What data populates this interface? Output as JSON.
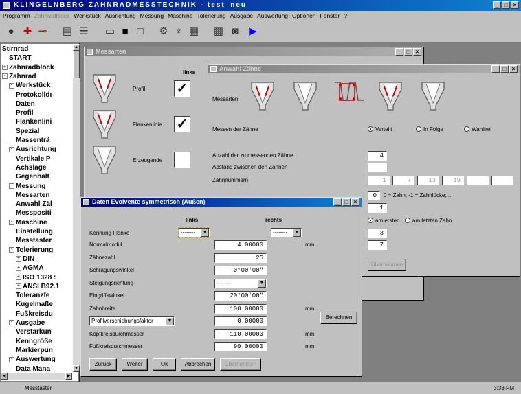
{
  "app": {
    "title": "KLINGELNBERG ZAHNRADMESSTECHNIK - test_neu"
  },
  "menu": [
    "Programm",
    "Zahnradblock",
    "Werkstück",
    "Ausrichtung",
    "Messung",
    "Maschine",
    "Tolerierung",
    "Ausgabe",
    "Auswertung",
    "Optionen",
    "Fenster",
    "?"
  ],
  "menu_disabled_index": 1,
  "tree": [
    {
      "label": "Stirnrad",
      "level": 0,
      "toggle": ""
    },
    {
      "label": "START",
      "level": 1,
      "toggle": ""
    },
    {
      "label": "Zahnradblock",
      "level": 0,
      "toggle": "+"
    },
    {
      "label": "Zahnrad",
      "level": 0,
      "toggle": "-"
    },
    {
      "label": "Werkstück",
      "level": 1,
      "toggle": "-"
    },
    {
      "label": "Protokolldı",
      "level": 2,
      "toggle": ""
    },
    {
      "label": "Daten",
      "level": 2,
      "toggle": ""
    },
    {
      "label": "Profil",
      "level": 2,
      "toggle": ""
    },
    {
      "label": "Flankenlini",
      "level": 2,
      "toggle": ""
    },
    {
      "label": "Spezial",
      "level": 2,
      "toggle": ""
    },
    {
      "label": "Massenträ",
      "level": 2,
      "toggle": ""
    },
    {
      "label": "Ausrichtung",
      "level": 1,
      "toggle": "-"
    },
    {
      "label": "Vertikale P",
      "level": 2,
      "toggle": ""
    },
    {
      "label": "Achslage",
      "level": 2,
      "toggle": ""
    },
    {
      "label": "Gegenhalt",
      "level": 2,
      "toggle": ""
    },
    {
      "label": "Messung",
      "level": 1,
      "toggle": "-"
    },
    {
      "label": "Messarten",
      "level": 2,
      "toggle": ""
    },
    {
      "label": "Anwahl Zäl",
      "level": 2,
      "toggle": ""
    },
    {
      "label": "Messpositi",
      "level": 2,
      "toggle": ""
    },
    {
      "label": "Maschine",
      "level": 1,
      "toggle": "-"
    },
    {
      "label": "Einstellung",
      "level": 2,
      "toggle": ""
    },
    {
      "label": "Messtaster",
      "level": 2,
      "toggle": ""
    },
    {
      "label": "Tolerierung",
      "level": 1,
      "toggle": "-"
    },
    {
      "label": "DIN",
      "level": 2,
      "toggle": "+"
    },
    {
      "label": "AGMA",
      "level": 2,
      "toggle": "+"
    },
    {
      "label": "ISO 1328 :",
      "level": 2,
      "toggle": "+"
    },
    {
      "label": "ANSI B92.1",
      "level": 2,
      "toggle": "+"
    },
    {
      "label": "Toleranzfe",
      "level": 2,
      "toggle": ""
    },
    {
      "label": "Kugelmaße",
      "level": 2,
      "toggle": ""
    },
    {
      "label": "Fußkreisdu",
      "level": 2,
      "toggle": ""
    },
    {
      "label": "Ausgabe",
      "level": 1,
      "toggle": "-"
    },
    {
      "label": "Verstärkun",
      "level": 2,
      "toggle": ""
    },
    {
      "label": "Kenngröße",
      "level": 2,
      "toggle": ""
    },
    {
      "label": "Markierpun",
      "level": 2,
      "toggle": ""
    },
    {
      "label": "Auswertung",
      "level": 1,
      "toggle": "-"
    },
    {
      "label": "Data Mana",
      "level": 2,
      "toggle": ""
    }
  ],
  "messarten": {
    "title": "Messarten",
    "col_header": "links",
    "rows": [
      {
        "label": "Profil",
        "checked": true
      },
      {
        "label": "Flankenlinie",
        "checked": true
      },
      {
        "label": "Erzeugende",
        "checked": false
      }
    ]
  },
  "anwahl": {
    "title": "Anwahl Zähne",
    "messarten_label": "Messarten",
    "messen_label": "Messen der Zähne",
    "radio_opts": [
      {
        "label": "Verteilt",
        "on": true
      },
      {
        "label": "In Folge",
        "on": false
      },
      {
        "label": "Wahlfrei",
        "on": false
      }
    ],
    "anzahl_label": "Anzahl der zu messenden Zähne",
    "anzahl_value": "4",
    "abstand_label": "Abstand zwischen den Zähnen",
    "abstand_value": "",
    "zahnnummern_label": "Zahnnummern",
    "zahnnummern": [
      "1",
      "7",
      "13",
      "19",
      "",
      ""
    ],
    "partial_label": "",
    "zahn_field_value": "0",
    "zahn_hint": "0 = Zahn; -1 = Zahnlücke; ...",
    "field2": "1",
    "start_opts": [
      {
        "label": "am ersten",
        "on": true
      },
      {
        "label": "am letzten Zahn",
        "on": false
      }
    ],
    "field3": "3",
    "field4": "7",
    "uebernehmen": "Übernehmen"
  },
  "daten": {
    "title": "Daten Evolvente symmetrisch (Außen)",
    "col_links": "links",
    "col_rechts": "rechts",
    "kennung_label": "Kennung Flanke",
    "kennung_links": "--------",
    "kennung_rechts": "--------",
    "rows": [
      {
        "label": "Normalmodul",
        "value": "4.00000",
        "unit": "mm",
        "type": "input"
      },
      {
        "label": "Zähnezahl",
        "value": "25",
        "unit": "",
        "type": "input"
      },
      {
        "label": "Schrägungswinkel",
        "value": "0°00'00\"",
        "unit": "",
        "type": "input"
      },
      {
        "label": "Steigungsrichtung",
        "value": "--------",
        "unit": "",
        "type": "select"
      },
      {
        "label": "Eingriffswinkel",
        "value": "20°00'00\"",
        "unit": "",
        "type": "input"
      },
      {
        "label": "Zahnbreite",
        "value": "100.00000",
        "unit": "mm",
        "type": "input"
      },
      {
        "label": "Profilverschiebungsfaktor",
        "value": "0.00000",
        "unit": "",
        "type": "labelselect"
      },
      {
        "label": "Kopfkreisdurchmesser",
        "value": "110.00000",
        "unit": "mm",
        "type": "input"
      },
      {
        "label": "Fußkreisdurchmesser",
        "value": "90.00000",
        "unit": "mm",
        "type": "input"
      }
    ],
    "berechnen": "Berechnen",
    "buttons": [
      {
        "label": "Zurück",
        "disabled": false
      },
      {
        "label": "Weiter",
        "disabled": false
      },
      {
        "label": "Ok",
        "disabled": false
      },
      {
        "label": "Abbrechen",
        "disabled": false
      },
      {
        "label": "Übernehmen",
        "disabled": true
      }
    ]
  },
  "status": {
    "left": "Messtaster",
    "right": "3:33 PM"
  },
  "colors": {
    "active_title": "#000080",
    "inactive_title": "#808080",
    "highlight": "#cc0000"
  }
}
